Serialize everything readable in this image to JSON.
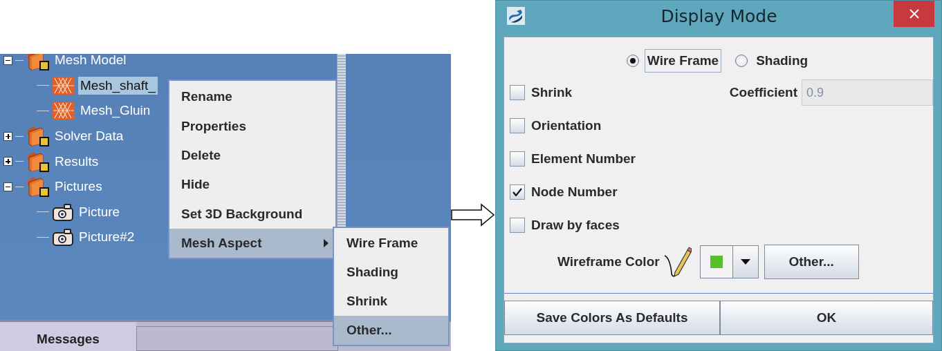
{
  "tree": {
    "items": [
      {
        "label": "Mesh Model",
        "kind": "folder",
        "expanded": true,
        "selected": false,
        "children": [
          {
            "label": "Mesh_shaft_",
            "kind": "mesh",
            "selected": true
          },
          {
            "label": "Mesh_Gluin",
            "kind": "mesh",
            "selected": false
          }
        ]
      },
      {
        "label": "Solver Data",
        "kind": "folder",
        "expanded": false,
        "selected": false
      },
      {
        "label": "Results",
        "kind": "folder",
        "expanded": false,
        "selected": false
      },
      {
        "label": "Pictures",
        "kind": "folder",
        "expanded": true,
        "selected": false,
        "children": [
          {
            "label": "Picture",
            "kind": "camera",
            "selected": false
          },
          {
            "label": "Picture#2",
            "kind": "camera",
            "selected": false
          }
        ]
      }
    ]
  },
  "context_menu": {
    "items": [
      {
        "label": "Rename",
        "selected": false
      },
      {
        "label": "Properties",
        "selected": false
      },
      {
        "label": "Delete",
        "selected": false
      },
      {
        "label": "Hide",
        "selected": false
      },
      {
        "label": "Set 3D Background",
        "selected": false
      },
      {
        "label": "Mesh Aspect",
        "selected": true,
        "submenu": true
      }
    ]
  },
  "submenu": {
    "items": [
      {
        "label": "Wire Frame",
        "selected": false
      },
      {
        "label": "Shading",
        "selected": false
      },
      {
        "label": "Shrink",
        "selected": false
      },
      {
        "label": "Other...",
        "selected": true
      }
    ]
  },
  "messages_tab": {
    "label": "Messages"
  },
  "dialog": {
    "title": "Display Mode",
    "modes": [
      {
        "label": "Wire Frame",
        "selected": true,
        "focused": true
      },
      {
        "label": "Shading",
        "selected": false,
        "focused": false
      }
    ],
    "options": [
      {
        "label": "Shrink",
        "checked": false,
        "coefficient": {
          "label": "Coefficient",
          "value": "0.9",
          "disabled": true
        }
      },
      {
        "label": "Orientation",
        "checked": false
      },
      {
        "label": "Element Number",
        "checked": false
      },
      {
        "label": "Node Number",
        "checked": true
      },
      {
        "label": "Draw by faces",
        "checked": false
      }
    ],
    "wireframe_color": {
      "label": "Wireframe Color",
      "color": "#55c02a",
      "button": "Other..."
    },
    "buttons": [
      "Save Colors As Defaults",
      "OK"
    ]
  }
}
